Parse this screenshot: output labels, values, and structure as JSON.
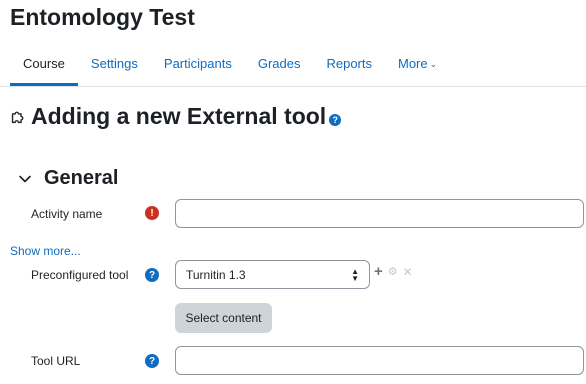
{
  "course": {
    "title": "Entomology Test"
  },
  "nav": {
    "course": "Course",
    "settings": "Settings",
    "participants": "Participants",
    "grades": "Grades",
    "reports": "Reports",
    "more": "More"
  },
  "page": {
    "heading": "Adding a new External tool",
    "help": "?"
  },
  "section": {
    "title": "General"
  },
  "form": {
    "activity_name_label": "Activity name",
    "activity_name_value": "",
    "required_mark": "!",
    "show_more": "Show more...",
    "preconfigured_label": "Preconfigured tool",
    "preconfigured_value": "Turnitin 1.3",
    "select_content_label": "Select content",
    "tool_url_label": "Tool URL",
    "tool_url_value": "",
    "help_mark": "?"
  },
  "colors": {
    "link": "#0f6cbf",
    "required": "#ca3120",
    "button_bg": "#ced4da"
  },
  "icons": {
    "puzzle": "puzzle-icon",
    "collapse": "chevron-down-icon",
    "add": "plus-icon",
    "edit": "gear-icon",
    "delete": "x-icon"
  }
}
